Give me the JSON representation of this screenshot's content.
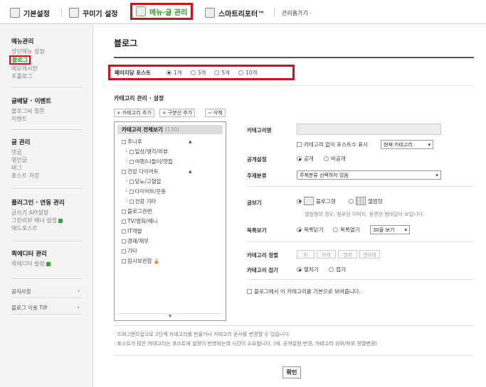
{
  "topnav": {
    "tabs": [
      {
        "label": "기본설정",
        "icon": "home-icon"
      },
      {
        "label": "꾸미기 설정",
        "icon": "palette-icon"
      },
      {
        "label": "메뉴·글 관리",
        "icon": "edit-icon",
        "active": true
      },
      {
        "label": "스마트리포터™",
        "icon": "chart-icon"
      }
    ],
    "admin_link": "관리홈가기 ·"
  },
  "sidebar": {
    "menu_group": {
      "title": "메뉴관리",
      "items": [
        "상단메뉴 설정",
        "블로그",
        "메모게시판",
        "프롤로그"
      ],
      "selected": "블로그"
    },
    "post_group": {
      "title": "글배달 · 이벤트",
      "items": [
        "블로그씨 질문",
        "이벤트"
      ]
    },
    "article_group": {
      "title": "글 관리",
      "items": [
        "댓글",
        "엮인글",
        "태그",
        "포스트 저장"
      ]
    },
    "plugin_group": {
      "title": "플러그인 · 연동 관리",
      "items": [
        "글쓰기 API설정",
        "그린리뷰 배너 설정",
        "애드포스트"
      ]
    },
    "editor_group": {
      "title": "퀵에디터 관리",
      "items": [
        "퀵에디터 설정"
      ]
    },
    "notice": "공지사항",
    "tip": "블로그 이용 TIP",
    "chevron": "›"
  },
  "main": {
    "title": "블로그",
    "per_page": {
      "label": "페이지당 포스트",
      "options": [
        "1개",
        "3개",
        "5개",
        "10개"
      ],
      "selected": "1개"
    },
    "category_section_title": "카테고리 관리 · 설정",
    "buttons": {
      "add_category": "카테고리 추가",
      "add_divider": "구분선 추가",
      "delete": "삭제"
    },
    "tree": {
      "header": "카테고리 전체보기",
      "header_count": "(130)",
      "items": [
        {
          "label": "주니루",
          "level": 0
        },
        {
          "label": "일상/생각/리뷰",
          "level": 1
        },
        {
          "label": "여행/나들이/맛집",
          "level": 1
        },
        {
          "label": "건강 다이어트",
          "level": 0
        },
        {
          "label": "당뇨/고혈압",
          "level": 1
        },
        {
          "label": "다이어트/운동",
          "level": 1
        },
        {
          "label": "건강 기타",
          "level": 1
        },
        {
          "label": "블로그관련",
          "level": 0
        },
        {
          "label": "TV/영화/예니",
          "level": 0
        },
        {
          "label": "IT개발",
          "level": 0
        },
        {
          "label": "경제/재무",
          "level": 0
        },
        {
          "label": "기타",
          "level": 0
        },
        {
          "label": "임시보관함",
          "level": 0
        }
      ]
    },
    "form": {
      "category_name_label": "카테고리명",
      "no_category_label": "카테고리 없이 포스트수 표시",
      "no_category_select": "현재 카테고리",
      "visibility_label": "공개설정",
      "visibility_options": [
        "공개",
        "비공개"
      ],
      "visibility_selected": "공개",
      "topic_label": "주제분류",
      "topic_select": "주제분류 선택하지 않음",
      "view_label": "글보기",
      "view_options": [
        "블로그형",
        "앨범형"
      ],
      "view_note": "앨범형의 경우, 첨부된 이미지, 동영상 썸네일이 보입니다.",
      "list_label": "목록보기",
      "list_options": [
        "목록닫기",
        "목록열기"
      ],
      "list_selected": "목록닫기",
      "list_count_select": "30줄 보기",
      "sort_label": "카테고리 정렬",
      "sort_buttons": [
        "위",
        "아래",
        "맨위",
        "맨아래"
      ],
      "fold_label": "카테고리 접기",
      "fold_options": [
        "펼치기",
        "접기"
      ],
      "fold_selected": "펼치기",
      "default_view_label": "블로그에서 이 카테고리를 기본으로 보여줍니다."
    },
    "notes": [
      "· 드래그앤드랍으로 2단계 카테고리를 만들거나 카테고리 순서를 변경할 수 있습니다.",
      "· 포스트가 많은 카테고리는 포스트에 설정이 반영되는데 시간이 소요됩니다. (예. 공개설정 변경, 카테고리 상위/하위 정렬변경)"
    ],
    "confirm": "확인"
  }
}
